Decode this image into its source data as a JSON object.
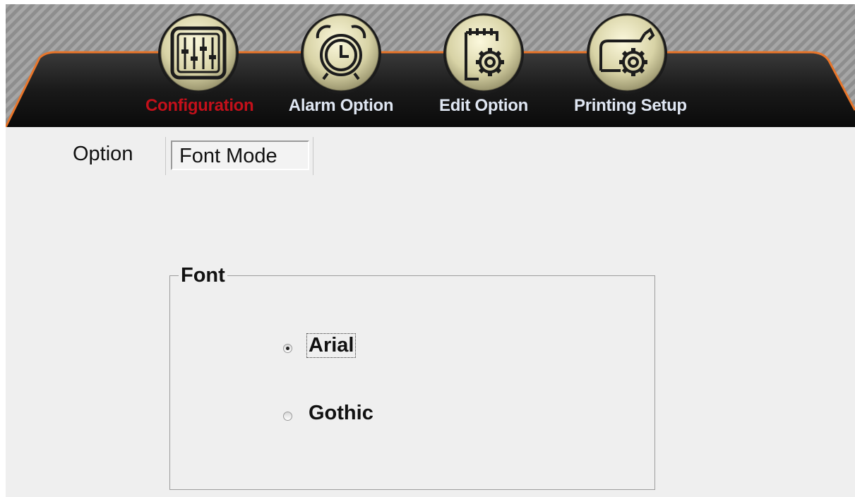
{
  "nav": {
    "items": [
      {
        "label": "Configuration",
        "icon": "sliders-icon",
        "active": true
      },
      {
        "label": "Alarm Option",
        "icon": "alarm-clock-icon",
        "active": false
      },
      {
        "label": "Edit Option",
        "icon": "notepad-gear-icon",
        "active": false
      },
      {
        "label": "Printing Setup",
        "icon": "printer-gear-icon",
        "active": false
      }
    ]
  },
  "tabs": {
    "option_label": "Option",
    "font_mode_label": "Font Mode"
  },
  "font_group": {
    "title": "Font",
    "options": [
      {
        "label": "Arial",
        "selected": true
      },
      {
        "label": "Gothic",
        "selected": false
      }
    ]
  },
  "colors": {
    "active_nav": "#c3101a",
    "inactive_nav": "#dfe6f2",
    "header_dark": "#151515",
    "accent_orange": "#e8752a"
  }
}
